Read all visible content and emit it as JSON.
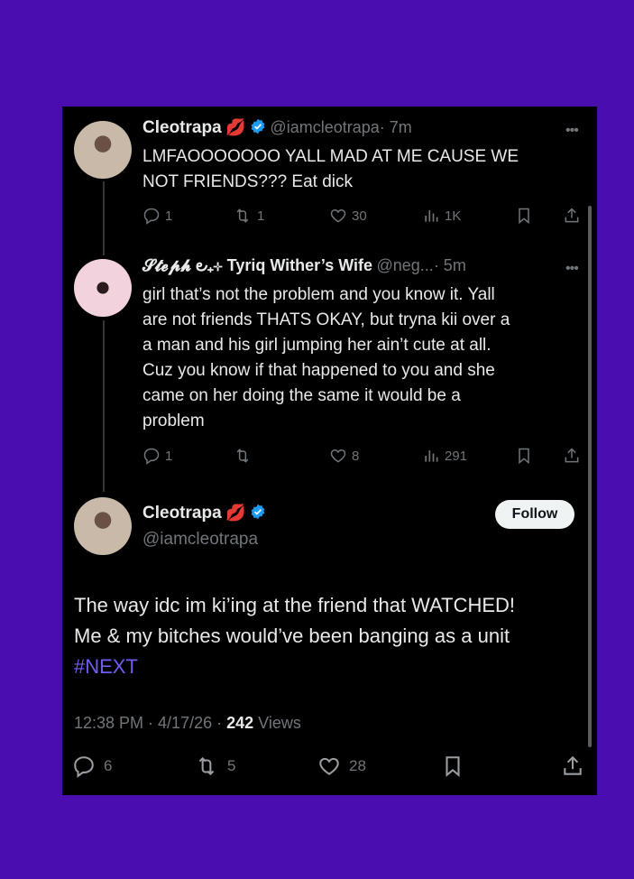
{
  "tweet1": {
    "display_name": "Cleotrapa",
    "emoji": "💋",
    "handle": "@iamcleotrapa",
    "time": "· 7m",
    "text_lines": [
      "LMFAOOOOOOO YALL MAD AT ME CAUSE WE",
      "NOT FRIENDS??? Eat dick"
    ],
    "replies": "1",
    "reposts": "1",
    "likes": "30",
    "views": "1K"
  },
  "tweet2": {
    "display_name": "𝓢𝓽𝓮𝓹𝓱 ౿₊⊹ Tyriq Wither’s Wife",
    "handle": "@neg...",
    "time": "· 5m",
    "text_lines": [
      "girl that’s not the problem and you know it. Yall",
      "are not friends THATS OKAY, but tryna kii over a",
      "a man and his girl jumping her ain’t cute at all.",
      "Cuz you know if that happened to you and she",
      "came on her doing the same it would be a",
      "problem"
    ],
    "replies": "1",
    "likes": "8",
    "views": "291"
  },
  "main": {
    "display_name": "Cleotrapa",
    "emoji": "💋",
    "handle": "@iamcleotrapa",
    "follow_label": "Follow",
    "text_lines": [
      "The way idc im ki’ing at the friend that WATCHED!",
      "Me & my bitches would’ve been banging as a unit"
    ],
    "hashtag": "#NEXT",
    "timestamp": "12:38 PM · 4/17/26 ·",
    "views_count": "242",
    "views_label": "Views",
    "replies": "6",
    "reposts": "5",
    "likes": "28"
  },
  "colors": {
    "accent": "#1d9bf0",
    "hashtag": "#6f5cf5",
    "background": "#4a0eb0"
  }
}
